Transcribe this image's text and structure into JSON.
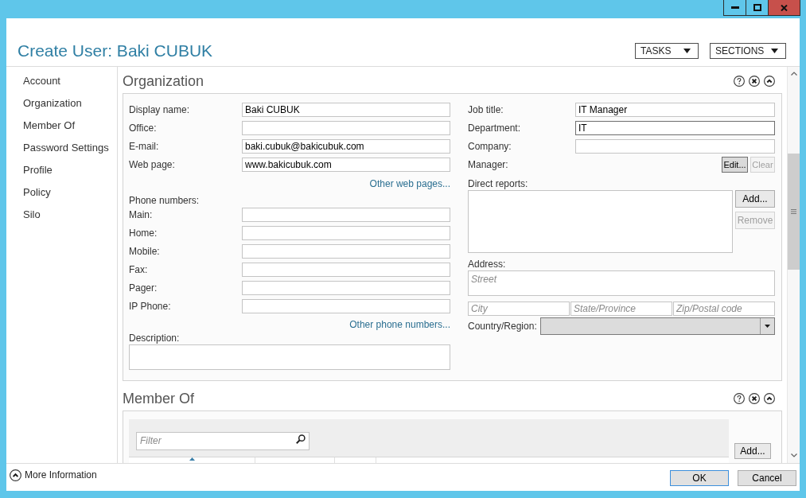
{
  "header": {
    "title": "Create User: Baki CUBUK",
    "buttons": [
      {
        "label": "TASKS"
      },
      {
        "label": "SECTIONS"
      }
    ]
  },
  "sidebar": {
    "items": [
      {
        "label": "Account",
        "selected": false
      },
      {
        "label": "Organization",
        "selected": false
      },
      {
        "label": "Member Of",
        "selected": false
      },
      {
        "label": "Password Settings",
        "selected": false
      },
      {
        "label": "Profile",
        "selected": false
      },
      {
        "label": "Policy",
        "selected": false
      },
      {
        "label": "Silo",
        "selected": false
      }
    ]
  },
  "organization": {
    "heading": "Organization",
    "left_fields": [
      {
        "label": "Display name:",
        "value": "Baki CUBUK"
      },
      {
        "label": "Office:"
      },
      {
        "label": "E-mail:",
        "value": "baki.cubuk@bakicubuk.com"
      },
      {
        "label": "Web page:",
        "value": "www.bakicubuk.com"
      }
    ],
    "web_pages_link": "Other web pages...",
    "phone_numbers": {
      "label": "Phone numbers:",
      "fields": [
        {
          "label": "Main:"
        },
        {
          "label": "Home:"
        },
        {
          "label": "Mobile:"
        },
        {
          "label": "Fax:"
        },
        {
          "label": "Pager:"
        },
        {
          "label": "IP Phone:"
        }
      ],
      "link": "Other phone numbers..."
    },
    "description": {
      "label": "Description:"
    },
    "right_fields": [
      {
        "label": "Job title:",
        "value": "IT Manager",
        "focused": false
      },
      {
        "label": "Department:",
        "value": "IT",
        "focused": true
      },
      {
        "label": "Company:",
        "focused": false
      }
    ],
    "manager": {
      "label": "Manager:",
      "buttons": [
        {
          "label": "Edit...",
          "disabled": false,
          "hovered": true
        },
        {
          "label": "Clear",
          "disabled": true,
          "hovered": false
        }
      ]
    },
    "direct_reports": {
      "label": "Direct reports:",
      "buttons": [
        {
          "label": "Add...",
          "disabled": false
        },
        {
          "label": "Remove",
          "disabled": true
        }
      ]
    },
    "address": {
      "label": "Address:",
      "street": {
        "placeholder": "Street"
      },
      "city": {
        "placeholder": "City"
      },
      "state": {
        "placeholder": "State/Province"
      },
      "zip": {
        "placeholder": "Zip/Postal code"
      }
    },
    "country": {
      "label": "Country/Region:",
      "disabled": true
    }
  },
  "member_of": {
    "heading": "Member Of",
    "filter": {
      "placeholder": "Filter"
    },
    "add_button": {
      "label": "Add..."
    }
  },
  "footer": {
    "more_information": "More Information",
    "buttons": [
      {
        "label": "OK",
        "default": true
      },
      {
        "label": "Cancel",
        "default": false
      }
    ]
  }
}
